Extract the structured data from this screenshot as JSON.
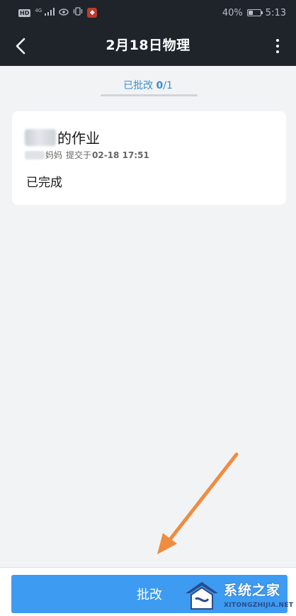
{
  "status_bar": {
    "hd": "HD",
    "signal": "4G",
    "battery": "40%",
    "battery_level": 0.4,
    "time": "5:13"
  },
  "nav": {
    "title": "2月18日物理",
    "back_icon": "chevron-left-icon",
    "more_icon": "more-vertical-icon"
  },
  "tab": {
    "label": "已批改",
    "graded": "0",
    "separator": "/",
    "total": "1"
  },
  "card": {
    "title_suffix": "的作业",
    "submitter_suffix": "妈妈",
    "submitted_prefix": "提交于",
    "submitted_time": "02-18 17:51",
    "status": "已完成"
  },
  "bottom": {
    "grade_button": "批改"
  },
  "watermark": {
    "text": "系统之家",
    "url_text": "XITONGZHIJIA.NET"
  },
  "colors": {
    "header_bg": "#1f232a",
    "accent": "#3d9bf2",
    "tab_text": "#3b8fd1",
    "annotation_arrow": "#ef8c3f"
  }
}
